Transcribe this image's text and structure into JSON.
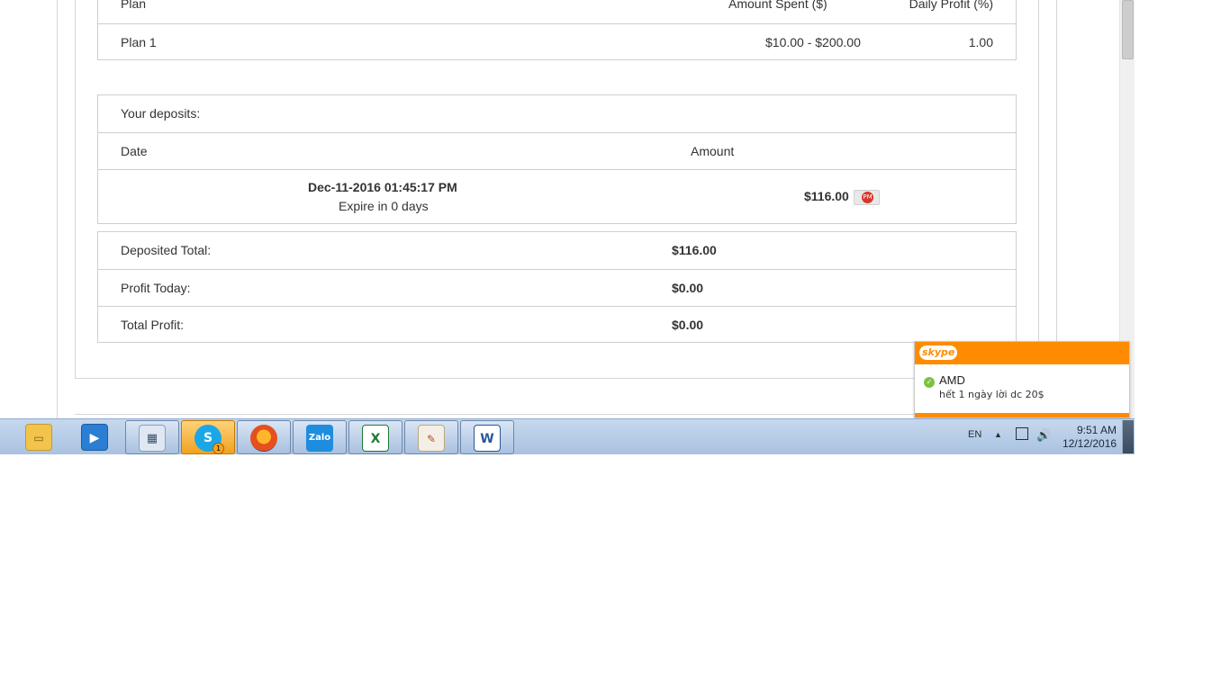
{
  "plan_table": {
    "headers": {
      "plan": "Plan",
      "amount_spent": "Amount Spent ($)",
      "daily_profit": "Daily Profit (%)"
    },
    "rows": [
      {
        "plan": "Plan 1",
        "amount_spent": "$10.00 - $200.00",
        "daily_profit": "1.00"
      }
    ]
  },
  "deposits": {
    "title": "Your deposits:",
    "headers": {
      "date": "Date",
      "amount": "Amount"
    },
    "rows": [
      {
        "date": "Dec-11-2016 01:45:17 PM",
        "expire": "Expire in 0 days",
        "amount": "$116.00",
        "processor_icon": "perfect-money-icon",
        "processor_label": "PM"
      }
    ]
  },
  "totals": [
    {
      "label": "Deposited Total:",
      "value": "$116.00"
    },
    {
      "label": "Profit Today:",
      "value": "$0.00"
    },
    {
      "label": "Total Profit:",
      "value": "$0.00"
    }
  ],
  "skype_notification": {
    "app_name": "skype",
    "sender": "AMD",
    "message": "hết 1 ngày lời dc 20$",
    "accent_color": "#ff8c00"
  },
  "taskbar": {
    "apps": [
      {
        "name": "windows-explorer",
        "icon": "folder-icon"
      },
      {
        "name": "media-player",
        "icon": "media-player-icon"
      },
      {
        "name": "calculator",
        "icon": "calculator-icon"
      },
      {
        "name": "skype",
        "icon": "skype-icon",
        "badge": "1",
        "active": true
      },
      {
        "name": "firefox",
        "icon": "firefox-icon"
      },
      {
        "name": "zalo",
        "icon": "zalo-icon",
        "label": "Zalo"
      },
      {
        "name": "excel",
        "icon": "excel-icon"
      },
      {
        "name": "paint",
        "icon": "paint-icon"
      },
      {
        "name": "word",
        "icon": "word-icon"
      }
    ],
    "tray": {
      "language": "EN",
      "time": "9:51 AM",
      "date": "12/12/2016"
    }
  }
}
